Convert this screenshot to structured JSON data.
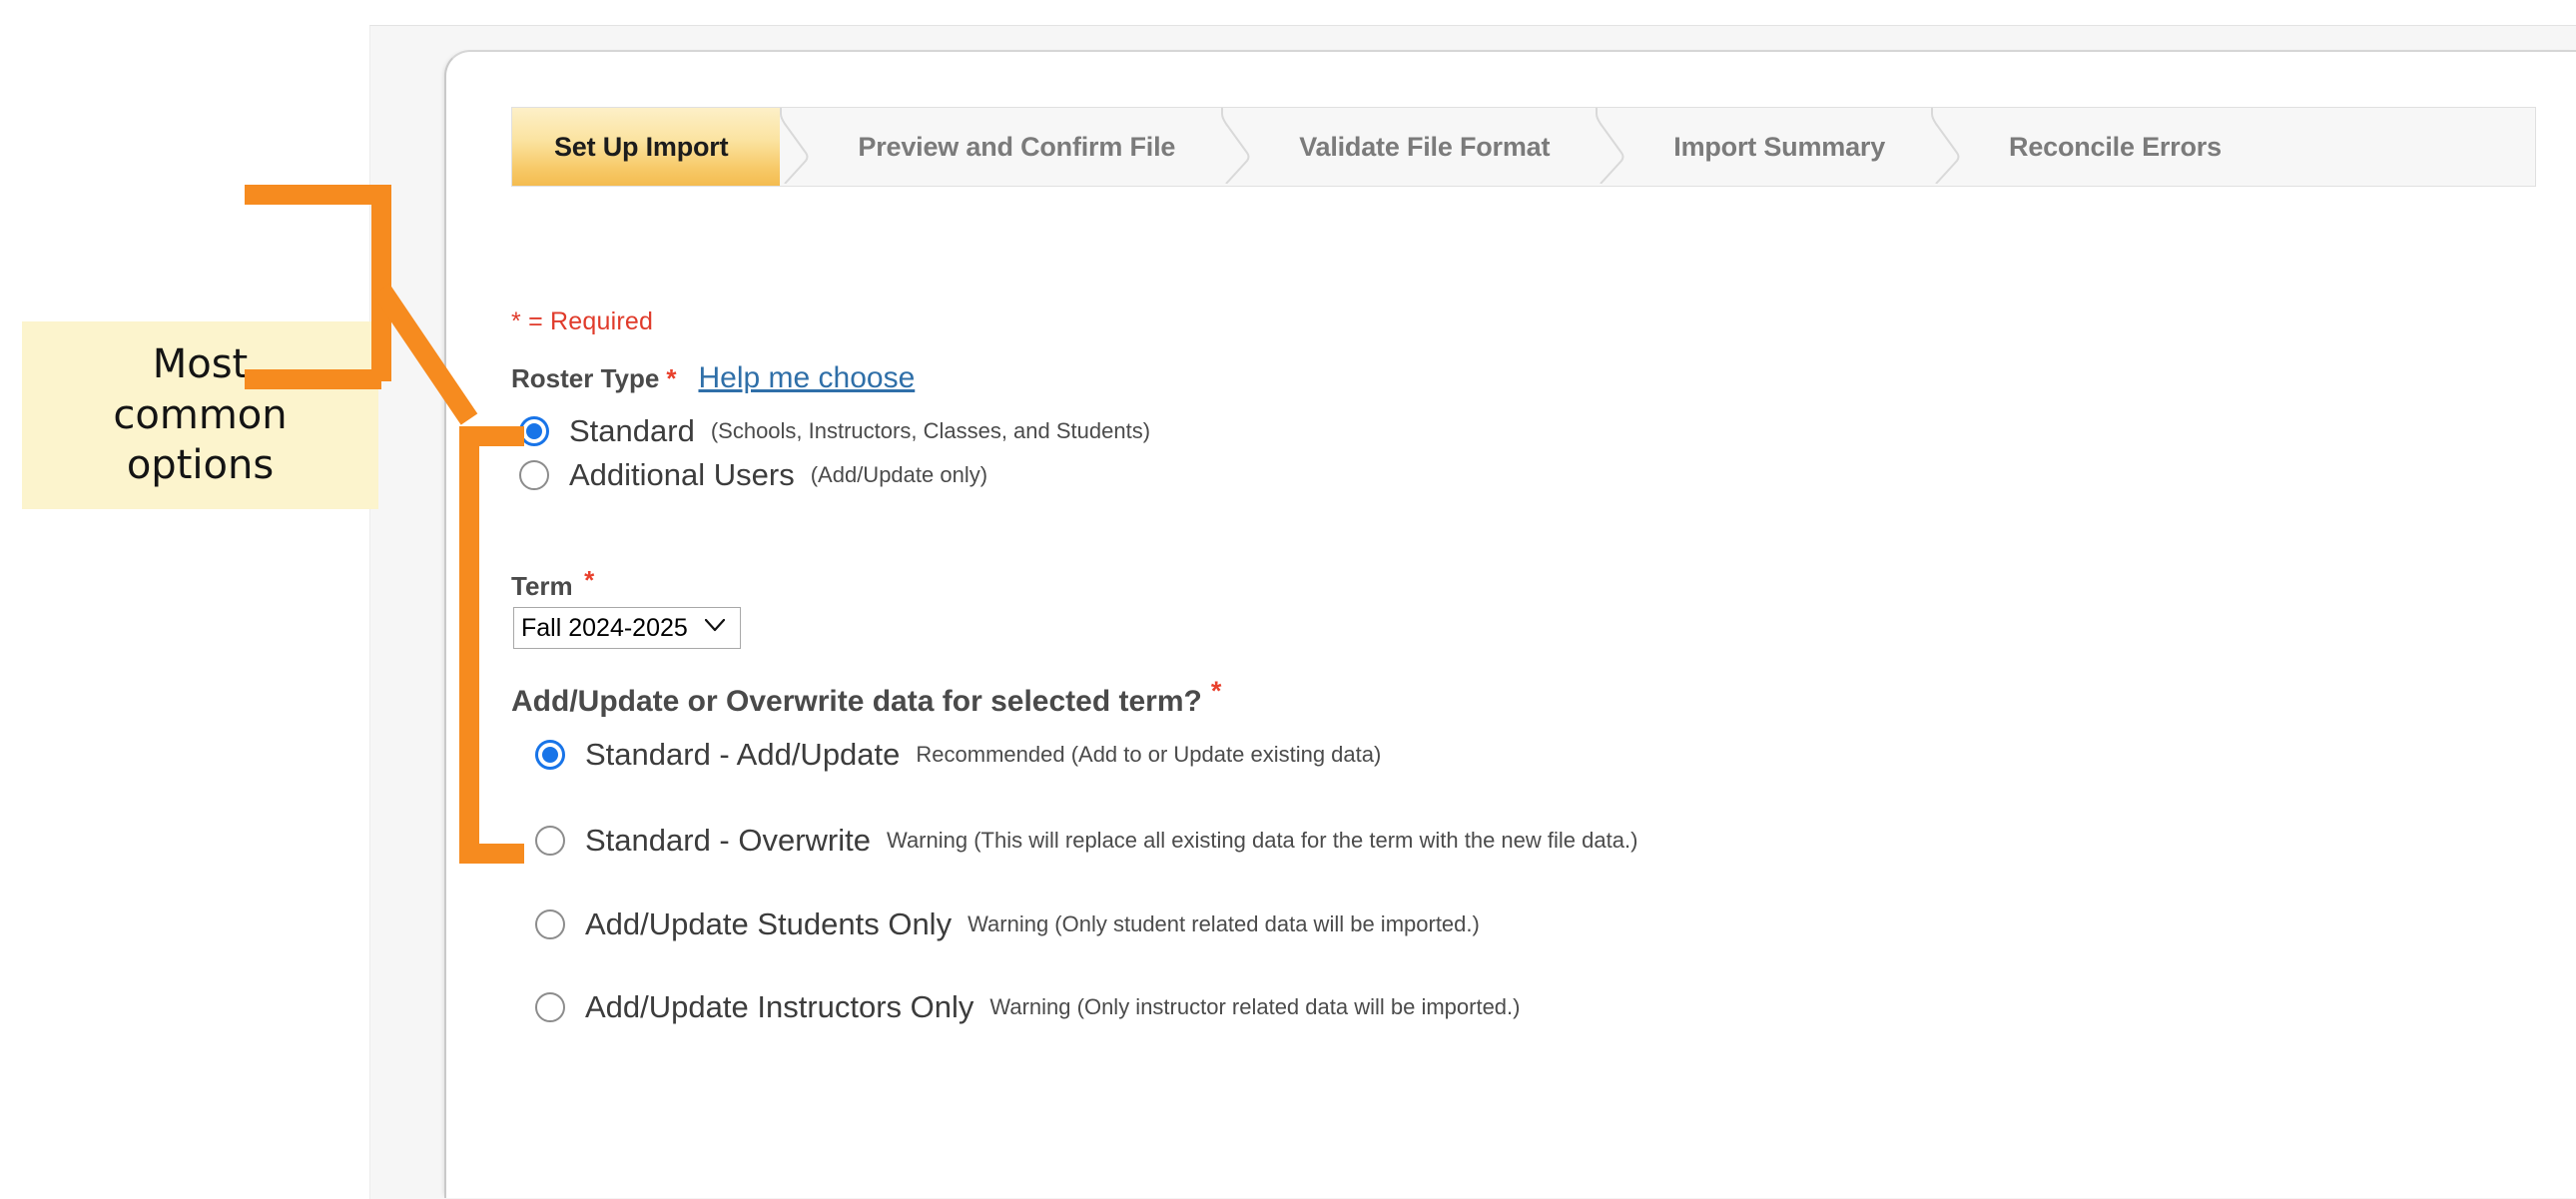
{
  "wizard": {
    "steps": [
      {
        "label": "Set Up Import",
        "active": true
      },
      {
        "label": "Preview and Confirm File",
        "active": false
      },
      {
        "label": "Validate File Format",
        "active": false
      },
      {
        "label": "Import Summary",
        "active": false
      },
      {
        "label": "Reconcile Errors",
        "active": false
      }
    ]
  },
  "form": {
    "required_note": "* = Required",
    "asterisk": "*",
    "roster_type": {
      "label": "Roster Type",
      "help_link": "Help me choose",
      "options": [
        {
          "label": "Standard",
          "note": "(Schools, Instructors, Classes, and Students)",
          "selected": true
        },
        {
          "label": "Additional Users",
          "note": "(Add/Update only)",
          "selected": false
        }
      ]
    },
    "term": {
      "label": "Term",
      "selected": "Fall 2024-2025",
      "options": [
        "Fall 2024-2025"
      ]
    },
    "overwrite": {
      "question": "Add/Update or Overwrite data for selected term?",
      "options": [
        {
          "label": "Standard - Add/Update",
          "note": "Recommended (Add to or Update existing data)",
          "selected": true
        },
        {
          "label": "Standard - Overwrite",
          "note": "Warning (This will replace all existing data for the term with the new file data.)",
          "selected": false
        },
        {
          "label": "Add/Update Students Only",
          "note": "Warning (Only student related data will be imported.)",
          "selected": false
        },
        {
          "label": "Add/Update Instructors Only",
          "note": "Warning (Only instructor related data will be imported.)",
          "selected": false
        }
      ]
    }
  },
  "annotation": {
    "callout_text": "Most\ncommon\noptions",
    "callout_line1": "Most",
    "callout_line2": "common",
    "callout_line3": "options"
  },
  "colors": {
    "accent_orange": "#F68B1F",
    "callout_fill": "#FCF4CD",
    "required_red": "#E8402C",
    "radio_blue": "#1874E8",
    "link_blue": "#2F6FA8",
    "active_tab_gold": "#F7C968"
  }
}
